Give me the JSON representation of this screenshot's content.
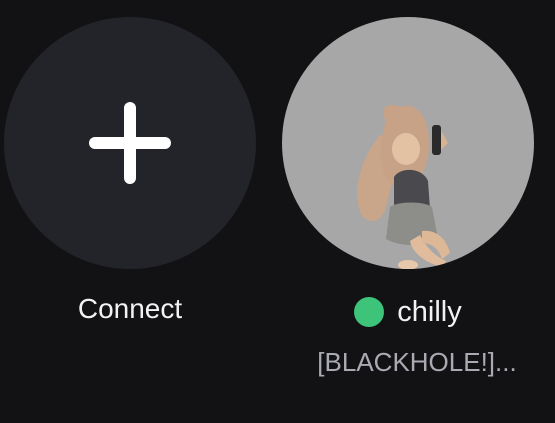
{
  "connect": {
    "label": "Connect",
    "icon": "plus-icon"
  },
  "friend": {
    "name": "chilly",
    "status_text": "[BLACKHOLE!]...",
    "presence": "online",
    "presence_color": "#3ec37a",
    "avatar_icon": "avatar-icon"
  },
  "colors": {
    "background": "#121215",
    "connect_tile": "#232429",
    "avatar_backdrop": "#a7a7a7",
    "primary_text": "#f2f2f2",
    "secondary_text": "#a9aab2"
  }
}
